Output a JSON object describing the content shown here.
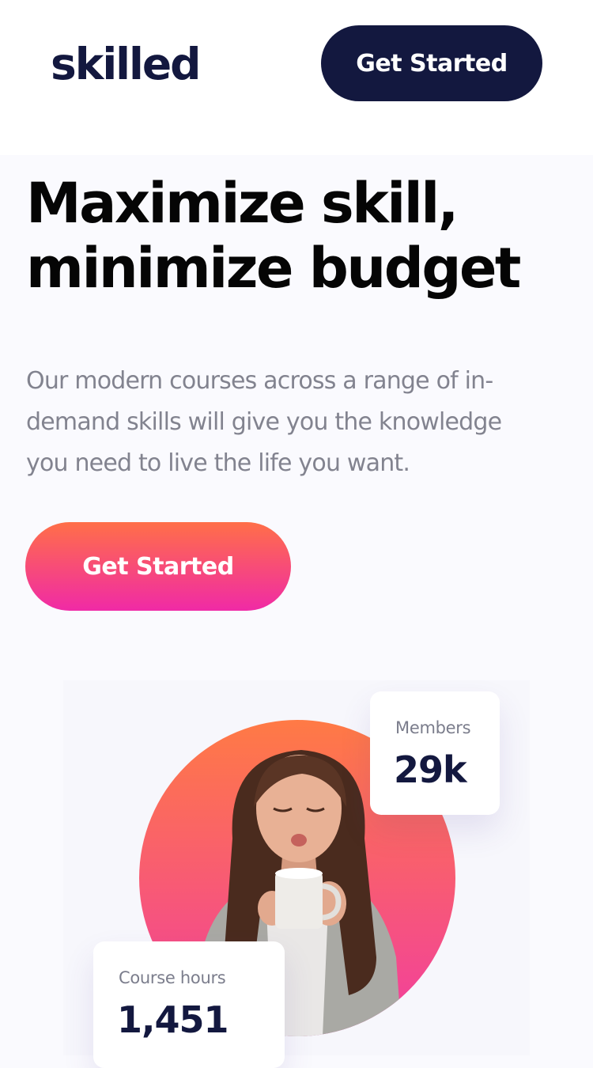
{
  "header": {
    "logo": "skilled",
    "cta_label": "Get Started"
  },
  "hero": {
    "title_line1": "Maximize skill,",
    "title_line2": "minimize budget",
    "description": "Our modern courses across a range of in-demand skills will give you the knowledge you need to live the life you want.",
    "cta_label": "Get Started"
  },
  "stats": {
    "members": {
      "label": "Members",
      "value": "29k"
    },
    "course_hours": {
      "label": "Course hours",
      "value": "1,451"
    }
  },
  "colors": {
    "navy": "#13183f",
    "gradient_top": "#ff6f48",
    "gradient_bottom": "#f02aa6",
    "muted_text": "#82838f"
  }
}
